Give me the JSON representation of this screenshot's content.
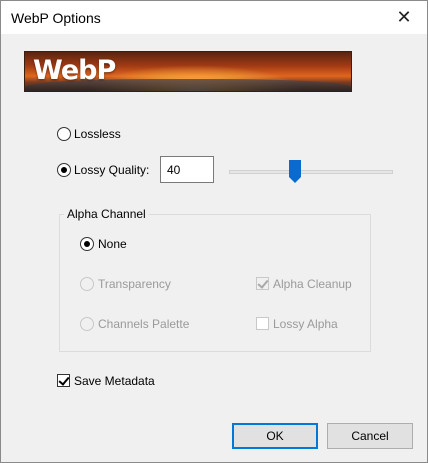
{
  "window": {
    "title": "WebP Options",
    "close_glyph": "✕"
  },
  "banner": {
    "logo_text": "WebP"
  },
  "compression": {
    "lossless_label": "Lossless",
    "lossy_label": "Lossy Quality:",
    "selected": "lossy",
    "quality_value": "40",
    "quality_fraction": 0.4
  },
  "alpha": {
    "group_label": "Alpha Channel",
    "none_label": "None",
    "transparency_label": "Transparency",
    "channels_palette_label": "Channels Palette",
    "alpha_cleanup_label": "Alpha Cleanup",
    "lossy_alpha_label": "Lossy Alpha",
    "selected": "none",
    "alpha_cleanup_checked": true,
    "lossy_alpha_checked": false
  },
  "metadata": {
    "save_label": "Save Metadata",
    "checked": true
  },
  "buttons": {
    "ok": "OK",
    "cancel": "Cancel"
  },
  "colors": {
    "accent": "#0078d7",
    "slider_thumb": "#0a6ad0",
    "dialog_bg": "#f0f0f0"
  }
}
